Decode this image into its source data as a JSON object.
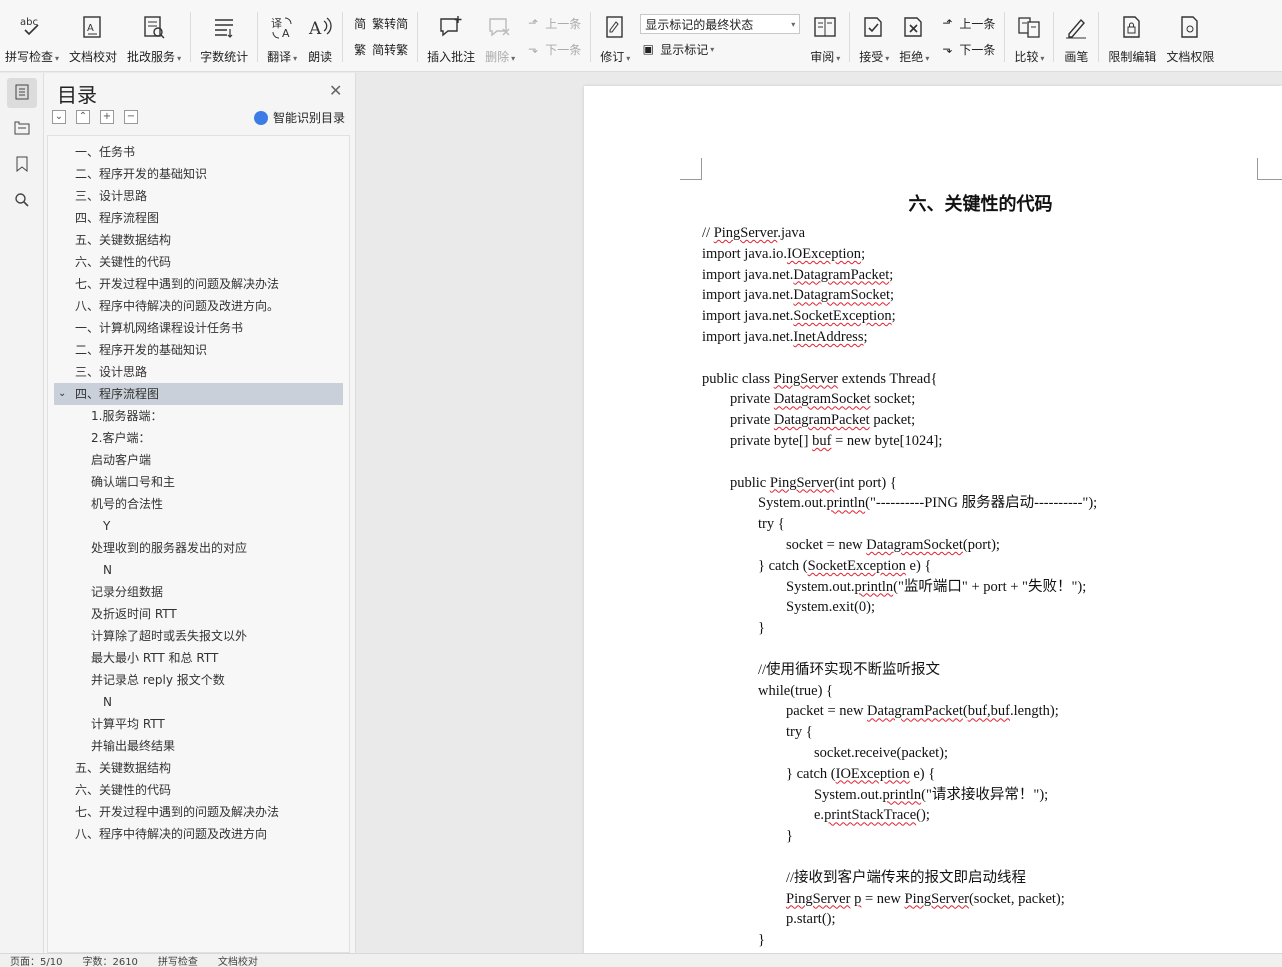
{
  "toolbar": {
    "spell_check": "拼写检查",
    "doc_proof": "文档校对",
    "review_service": "批改服务",
    "word_count": "字数统计",
    "translate": "翻译",
    "read_aloud": "朗读",
    "trad_to_simp": "繁转简",
    "simp_to_trad": "简转繁",
    "insert_comment": "插入批注",
    "delete": "删除",
    "prev_comment": "上一条",
    "next_comment": "下一条",
    "revise": "修订",
    "markup_select": "显示标记的最终状态",
    "show_markup": "显示标记",
    "review": "审阅",
    "accept": "接受",
    "reject": "拒绝",
    "prev_change": "上一条",
    "next_change": "下一条",
    "compare": "比较",
    "pen": "画笔",
    "restrict_edit": "限制编辑",
    "doc_rights": "文档权限"
  },
  "toc": {
    "title": "目录",
    "smart_label": "智能识别目录",
    "items": [
      {
        "label": "一、任务书",
        "level": 1
      },
      {
        "label": "二、程序开发的基础知识",
        "level": 1
      },
      {
        "label": "三、设计思路",
        "level": 1
      },
      {
        "label": "四、程序流程图",
        "level": 1
      },
      {
        "label": "五、关键数据结构",
        "level": 1
      },
      {
        "label": "六、关键性的代码",
        "level": 1
      },
      {
        "label": "七、开发过程中遇到的问题及解决办法",
        "level": 1
      },
      {
        "label": "八、程序中待解决的问题及改进方向。",
        "level": 1
      },
      {
        "label": "一、计算机网络课程设计任务书",
        "level": 1
      },
      {
        "label": "二、程序开发的基础知识",
        "level": 1
      },
      {
        "label": "三、设计思路",
        "level": 1
      },
      {
        "label": "四、程序流程图",
        "level": 1,
        "active": true
      },
      {
        "label": "1.服务器端：",
        "level": 2
      },
      {
        "label": "2.客户端：",
        "level": 2
      },
      {
        "label": "启动客户端",
        "level": 2
      },
      {
        "label": "确认端口号和主",
        "level": 2
      },
      {
        "label": "机号的合法性",
        "level": 2
      },
      {
        "label": "Y",
        "level": 3
      },
      {
        "label": "处理收到的服务器发出的对应",
        "level": 2
      },
      {
        "label": "N",
        "level": 3
      },
      {
        "label": "记录分组数据",
        "level": 2
      },
      {
        "label": "及折返时间 RTT",
        "level": 2
      },
      {
        "label": "计算除了超时或丢失报文以外",
        "level": 2
      },
      {
        "label": "最大最小 RTT 和总 RTT",
        "level": 2
      },
      {
        "label": "并记录总 reply 报文个数",
        "level": 2
      },
      {
        "label": "N",
        "level": 3
      },
      {
        "label": "计算平均 RTT",
        "level": 2
      },
      {
        "label": "并输出最终结果",
        "level": 2
      },
      {
        "label": "五、关键数据结构",
        "level": 1
      },
      {
        "label": "六、关键性的代码",
        "level": 1
      },
      {
        "label": "七、开发过程中遇到的问题及解决办法",
        "level": 1
      },
      {
        "label": "八、程序中待解决的问题及改进方向",
        "level": 1
      }
    ]
  },
  "document": {
    "heading": "六、关键性的代码",
    "code_lines": [
      {
        "indent": 0,
        "parts": [
          {
            "t": "// "
          },
          {
            "t": "PingServer",
            "sq": true
          },
          {
            "t": ".java"
          }
        ]
      },
      {
        "indent": 0,
        "parts": [
          {
            "t": "import java.io."
          },
          {
            "t": "IOException",
            "sq": true
          },
          {
            "t": ";"
          }
        ]
      },
      {
        "indent": 0,
        "parts": [
          {
            "t": "import java.net."
          },
          {
            "t": "DatagramPacket",
            "sq": true
          },
          {
            "t": ";"
          }
        ]
      },
      {
        "indent": 0,
        "parts": [
          {
            "t": "import java.net."
          },
          {
            "t": "DatagramSocket",
            "sq": true
          },
          {
            "t": ";"
          }
        ]
      },
      {
        "indent": 0,
        "parts": [
          {
            "t": "import java.net."
          },
          {
            "t": "SocketException",
            "sq": true
          },
          {
            "t": ";"
          }
        ]
      },
      {
        "indent": 0,
        "parts": [
          {
            "t": "import java.net."
          },
          {
            "t": "InetAddress",
            "sq": true
          },
          {
            "t": ";"
          }
        ]
      },
      {
        "indent": 0,
        "parts": [
          {
            "t": ""
          }
        ]
      },
      {
        "indent": 0,
        "parts": [
          {
            "t": "public class "
          },
          {
            "t": "PingServer",
            "sq": true
          },
          {
            "t": " extends Thread{"
          }
        ]
      },
      {
        "indent": 1,
        "parts": [
          {
            "t": "private "
          },
          {
            "t": "DatagramSocket",
            "sq": true
          },
          {
            "t": " socket;"
          }
        ]
      },
      {
        "indent": 1,
        "parts": [
          {
            "t": "private "
          },
          {
            "t": "DatagramPacket",
            "sq": true
          },
          {
            "t": " packet;"
          }
        ]
      },
      {
        "indent": 1,
        "parts": [
          {
            "t": "private byte[] "
          },
          {
            "t": "buf",
            "sq": true
          },
          {
            "t": " = new byte[1024];"
          }
        ]
      },
      {
        "indent": 0,
        "parts": [
          {
            "t": ""
          }
        ]
      },
      {
        "indent": 1,
        "parts": [
          {
            "t": "public "
          },
          {
            "t": "PingServer",
            "sq": true
          },
          {
            "t": "(int port) {"
          }
        ]
      },
      {
        "indent": 2,
        "parts": [
          {
            "t": "System.out."
          },
          {
            "t": "println",
            "sq": true
          },
          {
            "t": "(\"----------PING 服务器启动----------\");"
          }
        ]
      },
      {
        "indent": 2,
        "parts": [
          {
            "t": "try {"
          }
        ]
      },
      {
        "indent": 3,
        "parts": [
          {
            "t": "socket = new "
          },
          {
            "t": "DatagramSocket",
            "sq": true
          },
          {
            "t": "(port);"
          }
        ]
      },
      {
        "indent": 2,
        "parts": [
          {
            "t": "} catch ("
          },
          {
            "t": "SocketException",
            "sq": true
          },
          {
            "t": " e) {"
          }
        ]
      },
      {
        "indent": 3,
        "parts": [
          {
            "t": "System.out."
          },
          {
            "t": "println",
            "sq": true
          },
          {
            "t": "(\"监听端口\" + port + \"失败！\");"
          }
        ]
      },
      {
        "indent": 3,
        "parts": [
          {
            "t": "System.exit(0);"
          }
        ]
      },
      {
        "indent": 2,
        "parts": [
          {
            "t": "}"
          }
        ]
      },
      {
        "indent": 0,
        "parts": [
          {
            "t": ""
          }
        ]
      },
      {
        "indent": 2,
        "parts": [
          {
            "t": "//使用循环实现不断监听报文"
          }
        ]
      },
      {
        "indent": 2,
        "parts": [
          {
            "t": "while(true) {"
          }
        ]
      },
      {
        "indent": 3,
        "parts": [
          {
            "t": "packet = new "
          },
          {
            "t": "DatagramPacket",
            "sq": true
          },
          {
            "t": "("
          },
          {
            "t": "buf,buf",
            "sq": true
          },
          {
            "t": ".length);"
          }
        ]
      },
      {
        "indent": 3,
        "parts": [
          {
            "t": "try {"
          }
        ]
      },
      {
        "indent": 4,
        "parts": [
          {
            "t": "socket.receive(packet);"
          }
        ]
      },
      {
        "indent": 3,
        "parts": [
          {
            "t": "} catch ("
          },
          {
            "t": "IOException",
            "sq": true
          },
          {
            "t": " e) {"
          }
        ]
      },
      {
        "indent": 4,
        "parts": [
          {
            "t": "System.out."
          },
          {
            "t": "println",
            "sq": true
          },
          {
            "t": "(\"请求接收异常！\");"
          }
        ]
      },
      {
        "indent": 4,
        "parts": [
          {
            "t": "e."
          },
          {
            "t": "printStackTrace",
            "sq": true
          },
          {
            "t": "();"
          }
        ]
      },
      {
        "indent": 3,
        "parts": [
          {
            "t": "}"
          }
        ]
      },
      {
        "indent": 0,
        "parts": [
          {
            "t": ""
          }
        ]
      },
      {
        "indent": 3,
        "parts": [
          {
            "t": "//接收到客户端传来的报文即启动线程"
          }
        ]
      },
      {
        "indent": 3,
        "parts": [
          {
            "t": "PingServer",
            "sq": true
          },
          {
            "t": " "
          },
          {
            "t": "p",
            "sq": true
          },
          {
            "t": " = new "
          },
          {
            "t": "PingServer",
            "sq": true
          },
          {
            "t": "(socket, packet);"
          }
        ]
      },
      {
        "indent": 3,
        "parts": [
          {
            "t": "p.start();"
          }
        ]
      },
      {
        "indent": 2,
        "parts": [
          {
            "t": "}"
          }
        ]
      }
    ]
  },
  "status": {
    "page": "页面：5/10",
    "words": "字数：2610",
    "spell": "拼写检查",
    "proof": "文档校对"
  },
  "colors": {
    "accent": "#3d7ce6",
    "squiggle": "#dd2233",
    "toc_active": "#c9d0d9"
  }
}
